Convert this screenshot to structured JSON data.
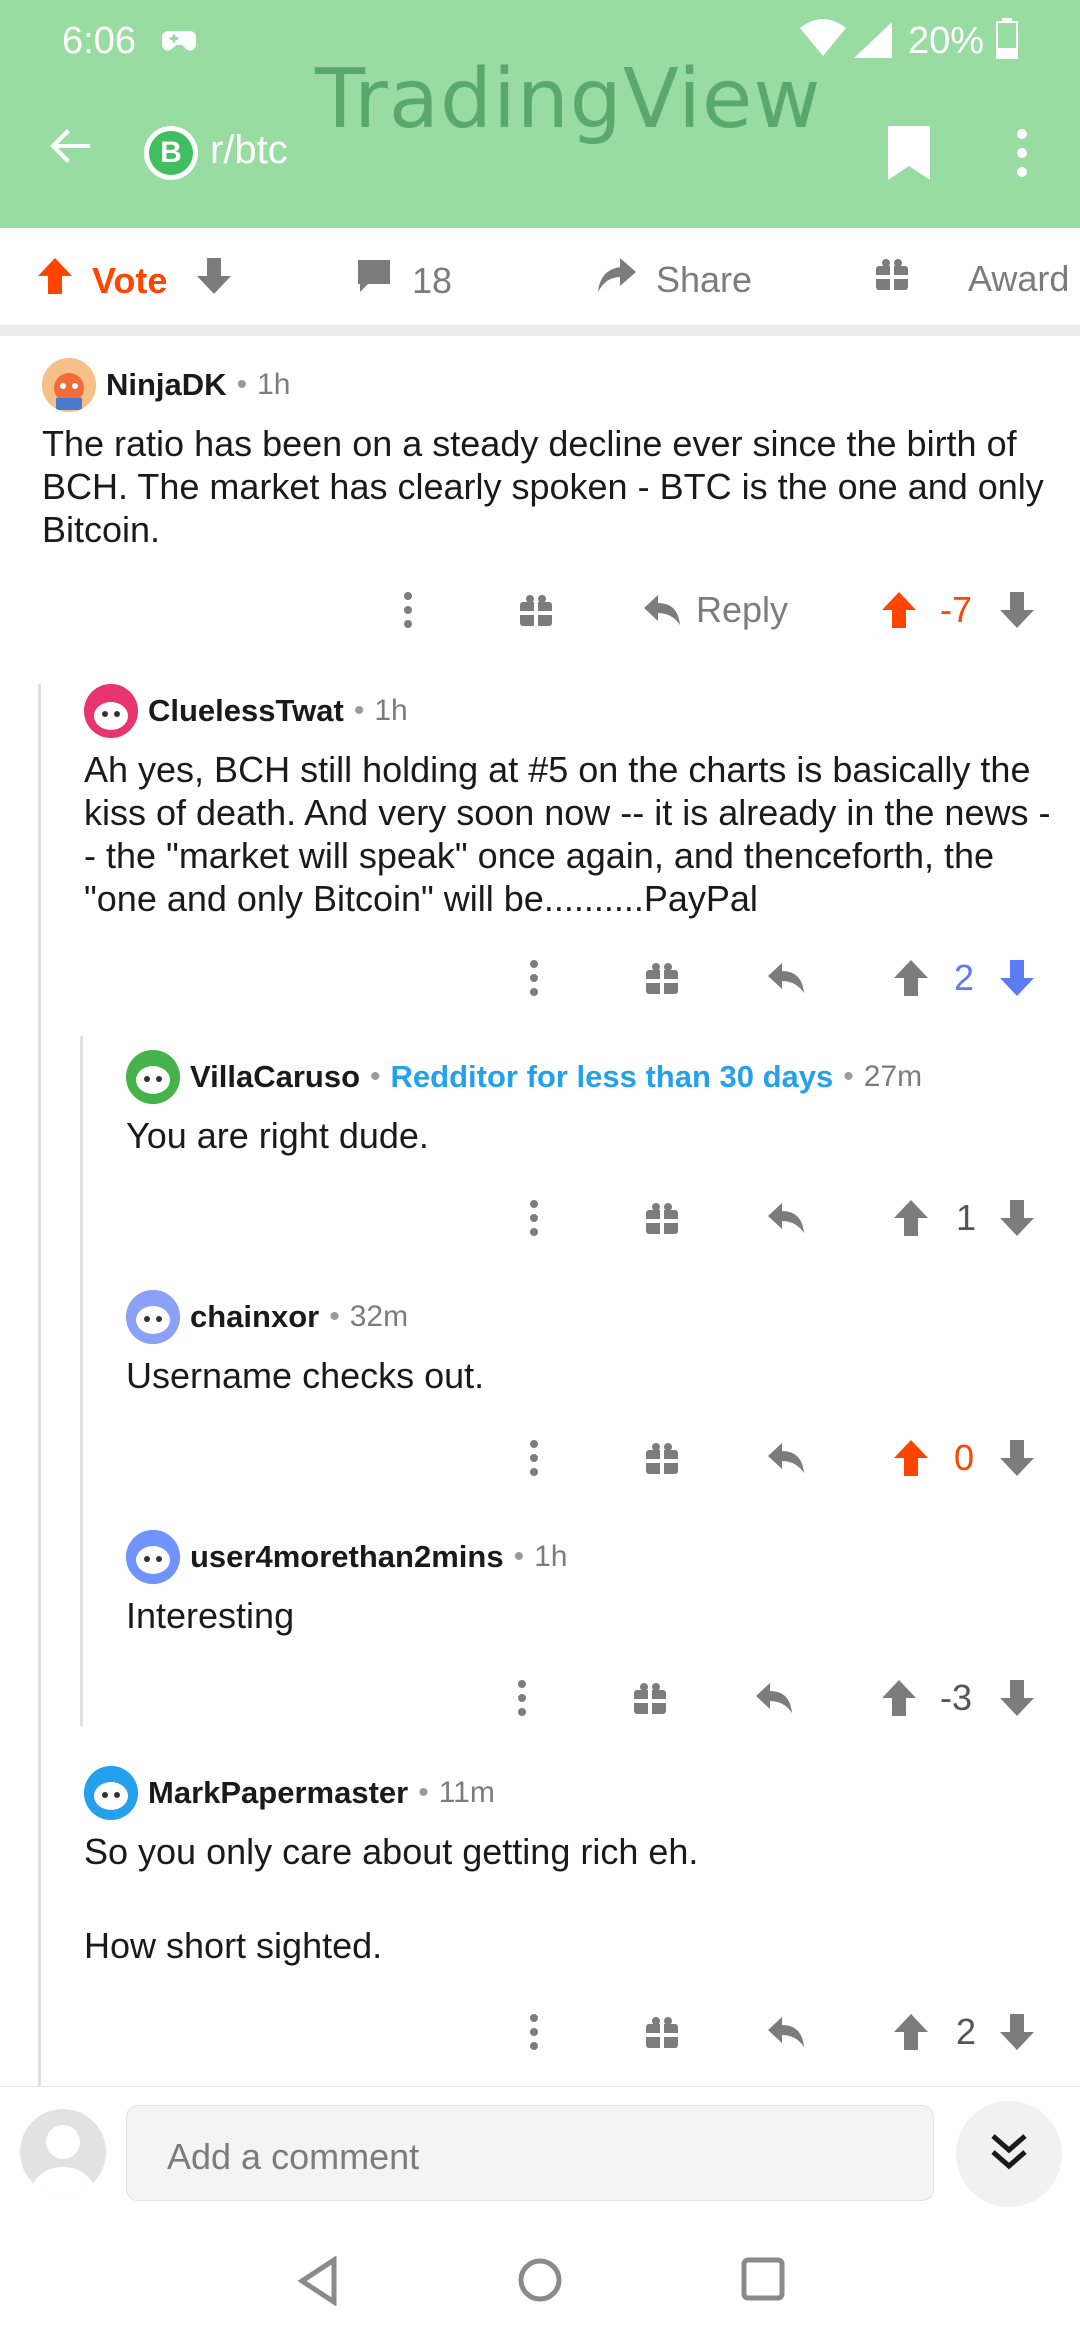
{
  "status_bar": {
    "time": "6:06",
    "battery": "20%"
  },
  "watermark": "TradingView",
  "header": {
    "subreddit": "r/btc",
    "sub_icon_letter": "B"
  },
  "post_actions": {
    "vote_label": "Vote",
    "comment_count": "18",
    "share_label": "Share",
    "award_label": "Award"
  },
  "comments": [
    {
      "username": "NinjaDK",
      "time": "1h",
      "body": "The ratio has been on a steady decline ever since the birth of BCH. The market has clearly spoken - BTC is the one and only Bitcoin.",
      "reply_label": "Reply",
      "score": "-7",
      "vote_state": "up"
    },
    {
      "username": "CluelessTwat",
      "time": "1h",
      "body": "Ah yes, BCH still holding at #5 on the charts is basically the kiss of death. And very soon now -- it is already in the news -- the \"market will speak\" once again, and thenceforth, the \"one and only Bitcoin\" will be..........PayPal",
      "score": "2",
      "vote_state": "down"
    },
    {
      "username": "VillaCaruso",
      "flair": "Redditor for less than 30 days",
      "time": "27m",
      "body": "You are right dude.",
      "score": "1",
      "vote_state": "none"
    },
    {
      "username": "chainxor",
      "time": "32m",
      "body": "Username checks out.",
      "score": "0",
      "vote_state": "up"
    },
    {
      "username": "user4morethan2mins",
      "time": "1h",
      "body": "Interesting",
      "score": "-3",
      "vote_state": "none"
    },
    {
      "username": "MarkPapermaster",
      "time": "11m",
      "body_line1": "So you only care about getting rich eh.",
      "body_line2": "How short sighted.",
      "score": "2",
      "vote_state": "none"
    }
  ],
  "comment_bar": {
    "placeholder": "Add a comment"
  },
  "colors": {
    "header_bg": "#98dca2",
    "upvote": "#ff4500",
    "downvote": "#5d7bf3",
    "flair": "#24a0ed"
  }
}
